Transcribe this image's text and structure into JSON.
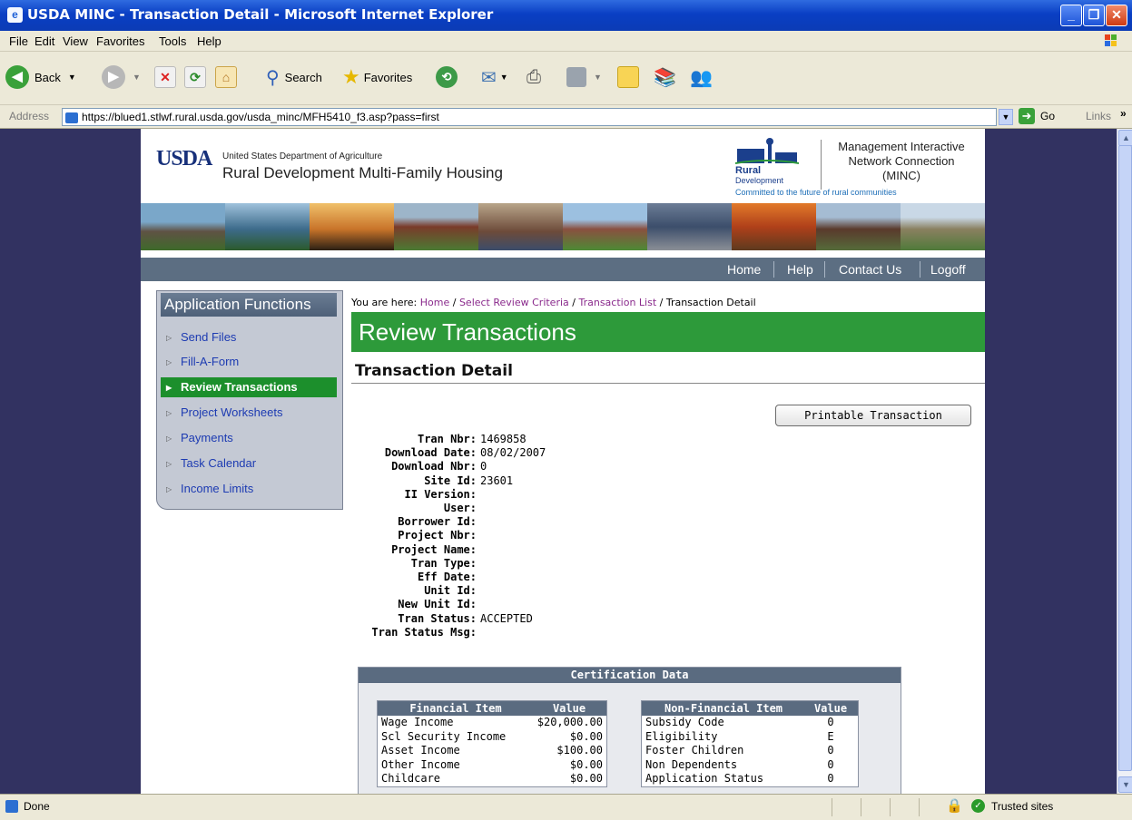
{
  "window": {
    "title": "USDA MINC - Transaction Detail - Microsoft Internet Explorer"
  },
  "menu": [
    "File",
    "Edit",
    "View",
    "Favorites",
    "Tools",
    "Help"
  ],
  "toolbar": {
    "back": "Back",
    "search": "Search",
    "favorites": "Favorites"
  },
  "address": {
    "label": "Address",
    "url": "https://blued1.stlwf.rural.usda.gov/usda_minc/MFH5410_f3.asp?pass=first",
    "go": "Go",
    "links": "Links"
  },
  "header": {
    "usda_logo": "USDA",
    "department": "United States Department of Agriculture",
    "site_name": "Rural Development Multi-Family Housing",
    "rd_logo_1": "Rural",
    "rd_logo_2": "Development",
    "tagline": "Committed to the future of rural communities",
    "minc_line1": "Management Interactive",
    "minc_line2": "Network Connection",
    "minc_line3": "(MINC)"
  },
  "topnav": [
    "Home",
    "Help",
    "Contact Us",
    "Logoff"
  ],
  "sidebar": {
    "title": "Application Functions",
    "items": [
      {
        "label": "Send Files",
        "active": false
      },
      {
        "label": "Fill-A-Form",
        "active": false
      },
      {
        "label": "Review Transactions",
        "active": true
      },
      {
        "label": "Project Worksheets",
        "active": false
      },
      {
        "label": "Payments",
        "active": false
      },
      {
        "label": "Task Calendar",
        "active": false
      },
      {
        "label": "Income Limits",
        "active": false
      }
    ]
  },
  "breadcrumb": {
    "prefix": "You are here:",
    "links": [
      "Home",
      "Select Review Criteria",
      "Transaction List"
    ],
    "current": "Transaction Detail"
  },
  "main": {
    "banner": "Review Transactions",
    "subheading": "Transaction Detail",
    "print_button": "Printable Transaction",
    "details": [
      {
        "label": "Tran Nbr:",
        "value": "1469858"
      },
      {
        "label": "Download Date:",
        "value": "08/02/2007"
      },
      {
        "label": "Download Nbr:",
        "value": "0"
      },
      {
        "label": "Site Id:",
        "value": "23601"
      },
      {
        "label": "II Version:",
        "value": ""
      },
      {
        "label": "User:",
        "value": ""
      },
      {
        "label": "Borrower Id:",
        "value": ""
      },
      {
        "label": "Project Nbr:",
        "value": ""
      },
      {
        "label": "Project Name:",
        "value": ""
      },
      {
        "label": "Tran Type:",
        "value": ""
      },
      {
        "label": "Eff Date:",
        "value": ""
      },
      {
        "label": "Unit Id:",
        "value": ""
      },
      {
        "label": "New Unit Id:",
        "value": ""
      },
      {
        "label": "Tran Status:",
        "value": "ACCEPTED"
      },
      {
        "label": "Tran Status Msg:",
        "value": ""
      }
    ]
  },
  "certification": {
    "title": "Certification Data",
    "financial": {
      "headers": [
        "Financial Item",
        "Value"
      ],
      "rows": [
        [
          "Wage Income",
          "$20,000.00"
        ],
        [
          "Scl Security Income",
          "$0.00"
        ],
        [
          "Asset Income",
          "$100.00"
        ],
        [
          "Other Income",
          "$0.00"
        ],
        [
          "Childcare",
          "$0.00"
        ]
      ]
    },
    "non_financial": {
      "headers": [
        "Non-Financial Item",
        "Value"
      ],
      "rows": [
        [
          "Subsidy Code",
          "0"
        ],
        [
          "Eligibility",
          "E"
        ],
        [
          "Foster Children",
          "0"
        ],
        [
          "Non Dependents",
          "0"
        ],
        [
          "Application Status",
          "0"
        ]
      ]
    }
  },
  "status": {
    "text": "Done",
    "zone": "Trusted sites"
  },
  "colors": {
    "band": "#323261",
    "green": "#2d9a3a",
    "nav": "#5c6e82"
  }
}
